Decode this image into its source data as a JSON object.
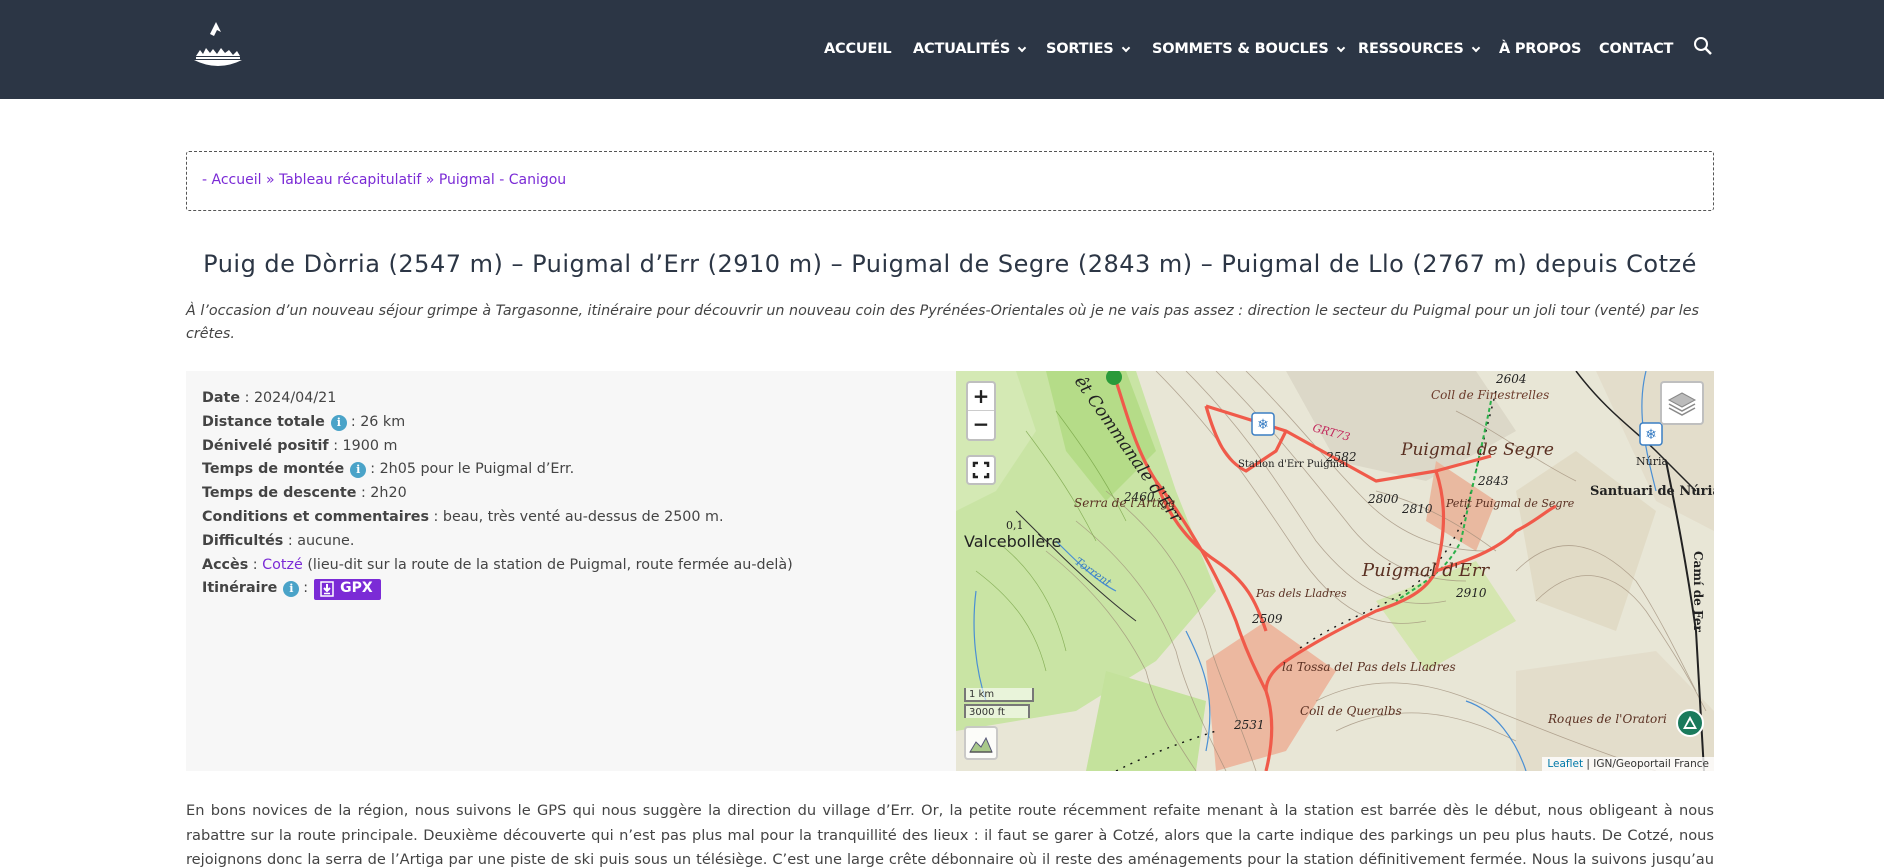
{
  "header": {
    "nav": [
      {
        "label": "ACCUEIL",
        "dropdown": false
      },
      {
        "label": "ACTUALITÉS",
        "dropdown": true
      },
      {
        "label": "SORTIES",
        "dropdown": true
      },
      {
        "label": "SOMMETS & BOUCLES",
        "dropdown": true
      },
      {
        "label": "RESSOURCES",
        "dropdown": true
      },
      {
        "label": "À PROPOS",
        "dropdown": false
      },
      {
        "label": "CONTACT",
        "dropdown": false
      }
    ],
    "search_icon": "search-icon",
    "bg_color": "#2c3645"
  },
  "breadcrumb": {
    "prefix": "- ",
    "items": [
      "Accueil",
      "Tableau récapitulatif",
      "Puigmal - Canigou"
    ],
    "separator": " » "
  },
  "page": {
    "title": "Puig de Dòrria (2547 m) – Puigmal d’Err (2910 m) – Puigmal de Segre (2843 m) – Puigmal de Llo (2767 m) depuis Cotzé",
    "intro": "À l’occasion d’un nouveau séjour grimpe à Targasonne, itinéraire pour découvrir un nouveau coin des Pyrénées-Orientales où je ne vais pas assez : direction le secteur du Puigmal pour un joli tour (venté) par les crêtes."
  },
  "info": {
    "date_label": "Date",
    "date_value": " : 2024/04/21",
    "distance_label": "Distance totale",
    "distance_value": ": 26 km",
    "denivele_label": "Dénivelé positif",
    "denivele_value": " : 1900 m",
    "montee_label": "Temps de montée",
    "montee_value": ": 2h05 pour le Puigmal d’Err.",
    "descente_label": "Temps de descente",
    "descente_value": " : 2h20",
    "conditions_label": "Conditions et commentaires",
    "conditions_value": " : beau, très venté au-dessus de 2500 m.",
    "difficultes_label": "Difficultés",
    "difficultes_value": " : aucune.",
    "acces_label": "Accès",
    "acces_sep": " : ",
    "acces_link": "Cotzé",
    "acces_value": " (lieu-dit sur la route de la station de Puigmal, route fermée au-delà)",
    "itineraire_label": "Itinéraire",
    "itineraire_sep": " :",
    "gpx_label": "GPX",
    "accent_color": "#7b2bd6"
  },
  "map": {
    "zoom_in": "+",
    "zoom_out": "−",
    "scale_km": "1 km",
    "scale_ft": "3000 ft",
    "attribution_leaflet": "Leaflet",
    "attribution_sep": " | ",
    "attribution_ign": "IGN/Geoportail France",
    "labels": {
      "commanale": "êt Commanale d'Err",
      "coll_finestrelles": "Coll de Finestrelles",
      "gr": "GRT73",
      "station": "Station d'Err Puigmal",
      "v2582": "2582",
      "puigmal_segre": "Puigmal de Segre",
      "v2604": "2604",
      "nuria": "Núria",
      "santuari": "Santuari de Núria",
      "v2843": "2843",
      "v2800": "2800",
      "v2810": "2810",
      "petit": "Petit Puigmal de Segre",
      "serra": "Serra de l'Artiga",
      "v2460": "2460",
      "v01": "0,1",
      "valcebollere": "Valcebollère",
      "puigmal_err": "Puigmal d'Err",
      "v2910": "2910",
      "pas_lladres": "Pas dels Lladres",
      "v2509": "2509",
      "tossa": "la Tossa del Pas dels Lladres",
      "coll_queralbs": "Coll de Queralbs",
      "v2531": "2531",
      "roques": "Roques de l'Oratori",
      "cami": "Camí de Fer",
      "torrent": "Torrent"
    }
  },
  "body_text": "En bons novices de la région, nous suivons le GPS qui nous suggère la direction du village d’Err. Or, la petite route récemment refaite menant à la station est barrée dès le début, nous obligeant à nous rabattre sur la route principale. Deuxième découverte qui n’est pas plus mal pour la tranquillité des lieux : il faut se garer à Cotzé, alors que la carte indique des parkings un peu plus hauts. De Cotzé, nous rejoignons donc la serra de l’Artiga par une piste de ski puis sous un télésiège. C’est une large crête débonnaire où il reste des aménagements pour la station définitivement fermée. Nous la suivons jusqu’au pic de"
}
